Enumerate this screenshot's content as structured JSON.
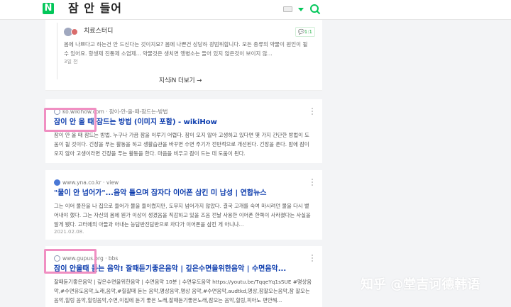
{
  "header": {
    "logo": "N",
    "query": "잠 안 들어",
    "colors": {
      "brand": "#03c75a",
      "link": "#0b3bad",
      "highlight": "#f08fc2"
    }
  },
  "answer_card": {
    "author": "치료스터디",
    "badge": "💬1:1",
    "text": "몸에 나쁘다고 하는건 안 드신다는 것이지요? 몸에 나쁜건 상당하 광범위합니다. 모든 종류의 약물이 원인이 될 수 있어요. 항생제 진통제 소염제... 약물것은 생치면 앵병소는 들어 있지 않은것이 보이지 않...",
    "date": "3일 전",
    "more_label": "지식iN 더보기 →"
  },
  "results": [
    {
      "source": "ko.wikihow.com · 잠이-안-올-때-잠드는-방법",
      "title": "잠이 안 올 때 잠드는 방법 (이미지 포함) - wikiHow",
      "snippet": "잠이 안 올 때 잠드는 방법. 누구나 가끔 잠을 이루기 어렵다. 잠이 오지 않아 고생하고 있다면 몇 가지 간단한 방법이 도움이 될 것이다. 긴장을 푸는 활동을 하고 생활습관을 바꾸면 수면 주기가 전반적으로 개선된다. 긴장을 푼다. 밤에 잠이 오지 않아 고생이라면 긴장을 푸는 활동을 한다. 마음을 비우고 잠이 드는 데 도움이 된다."
    },
    {
      "source": "www.yna.co.kr · view",
      "title": "\"물이 안 넘어가\"...음악 틀으며 잠자다 이어폰 삼킨 미 남성 | 연합뉴스",
      "snippet": "그는 이어 물잔을 나 집으로 들어가 물을 들이켰지만, 도무지 넘어가지 않았다. 결국 고개를 숙여 마시려던 물을 다시 뱉어내야 했다. 그는 자신의 몸에 뭔가 이상이 생겼음을 직감하고 있을 즈음 전날 사용한 이어폰 한쪽이 사라졌다는 사실을 알게 됐다. 고터에의 아들과 아내는 농담반진담반으로 차다가 이어폰을 삼킨 게 아니냐...",
      "date": "2021.02.08."
    },
    {
      "source": "www.gupus.org · bbs",
      "title": "잠이 안올때 듣는 음악! 잘때듣기좋은음악 | 깊은수면을위한음악 | 수면음악...",
      "snippet": "잘때듣기좋은음악 | 깊은수면을위한음악 | 수면음악 10분 | 수면유도음악 https://youtu.be/TqqeYq1sSUE #명상음악,#수면유도음악,노래,음악,#힐잘때 듣는 음악,명상음악,명상 음악,#수면음악,audtkd,명상,잠잘오는음악,잠 잘오는 음악,힐링 음악,힐링음악,수면,이집에 듣기 좋은 노래,잘때듣기좋은노래,잠오는 음악,힐링,피아노 편안해..."
    }
  ],
  "watermark": "知乎 @堂吉诃德韩语"
}
